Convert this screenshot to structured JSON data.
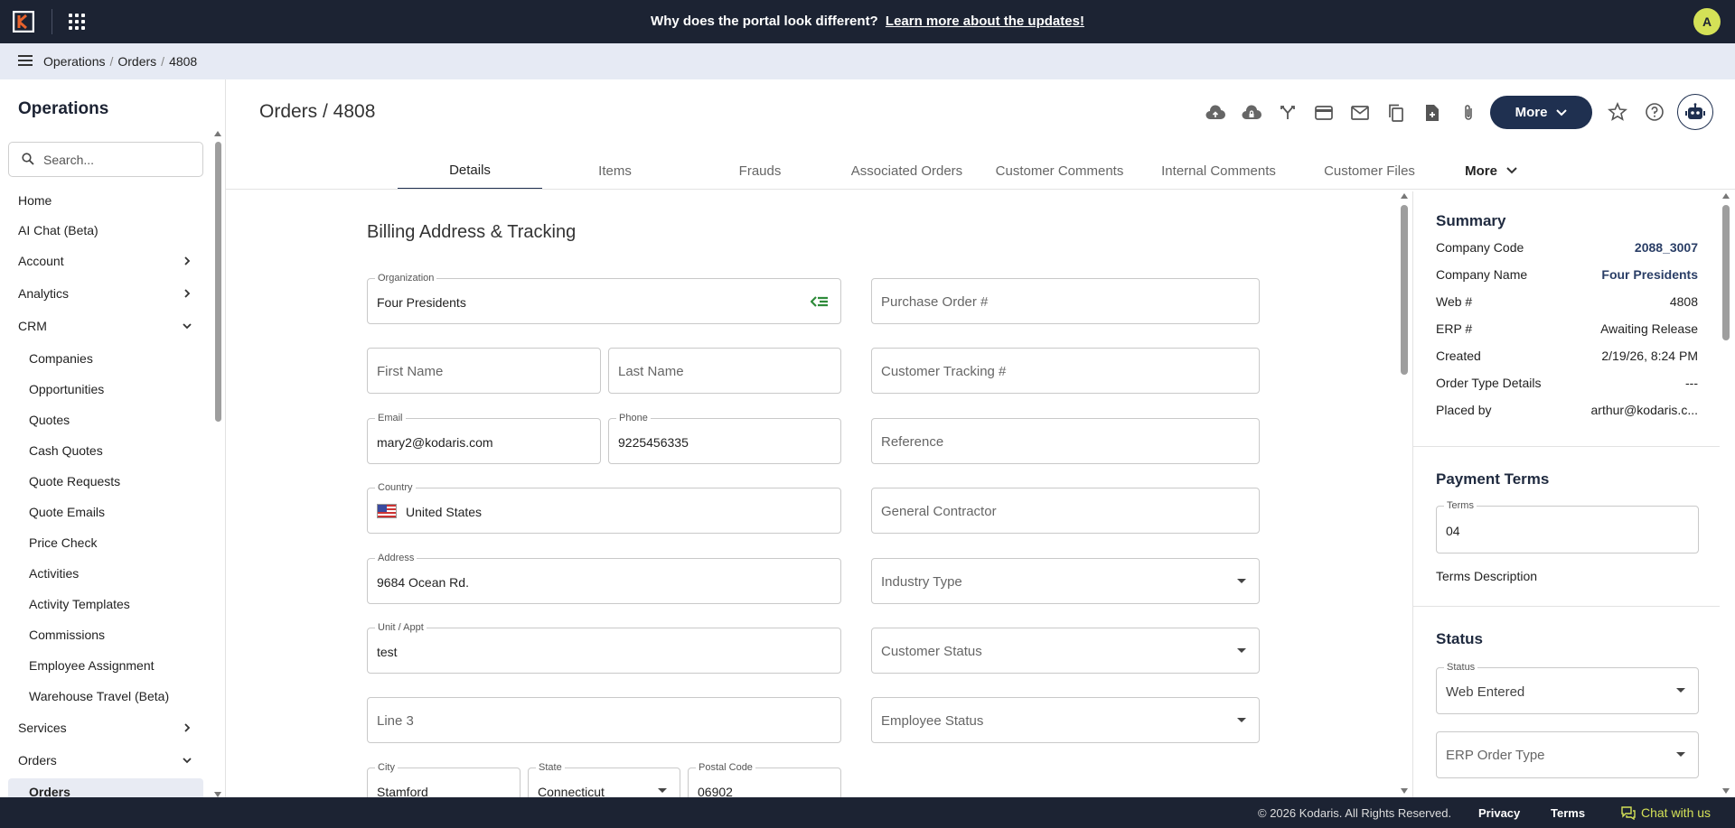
{
  "topbar": {
    "announcement": "Why does the portal look different?",
    "announcement_link": "Learn more about the updates!",
    "avatar_initial": "A"
  },
  "breadcrumb": [
    "Operations",
    "Orders",
    "4808"
  ],
  "sidebar": {
    "title": "Operations",
    "search_placeholder": "Search...",
    "items": [
      {
        "label": "Home",
        "level": "top"
      },
      {
        "label": "AI Chat (Beta)",
        "level": "top"
      },
      {
        "label": "Account",
        "level": "top",
        "chevron": "right"
      },
      {
        "label": "Analytics",
        "level": "top",
        "chevron": "right"
      },
      {
        "label": "CRM",
        "level": "top",
        "chevron": "down"
      },
      {
        "label": "Companies",
        "level": "sub"
      },
      {
        "label": "Opportunities",
        "level": "sub"
      },
      {
        "label": "Quotes",
        "level": "sub"
      },
      {
        "label": "Cash Quotes",
        "level": "sub"
      },
      {
        "label": "Quote Requests",
        "level": "sub"
      },
      {
        "label": "Quote Emails",
        "level": "sub"
      },
      {
        "label": "Price Check",
        "level": "sub"
      },
      {
        "label": "Activities",
        "level": "sub"
      },
      {
        "label": "Activity Templates",
        "level": "sub"
      },
      {
        "label": "Commissions",
        "level": "sub"
      },
      {
        "label": "Employee Assignment",
        "level": "sub"
      },
      {
        "label": "Warehouse Travel (Beta)",
        "level": "sub"
      },
      {
        "label": "Services",
        "level": "top",
        "chevron": "right"
      },
      {
        "label": "Orders",
        "level": "top",
        "chevron": "down"
      },
      {
        "label": "Orders",
        "level": "sub",
        "active": true
      }
    ]
  },
  "header": {
    "title": "Orders / 4808",
    "more_label": "More",
    "toolbar_icons": [
      "cloud-upload-icon",
      "cloud-lock-icon",
      "merge-icon",
      "credit-card-icon",
      "mail-icon",
      "copy-icon",
      "file-add-icon",
      "attachment-icon"
    ]
  },
  "tabs": [
    {
      "label": "Details",
      "active": true
    },
    {
      "label": "Items"
    },
    {
      "label": "Frauds"
    },
    {
      "label": "Associated Orders"
    },
    {
      "label": "Customer Comments"
    },
    {
      "label": "Internal Comments"
    },
    {
      "label": "Customer Files"
    },
    {
      "label": "More"
    }
  ],
  "form": {
    "section_title": "Billing Address & Tracking",
    "organization": {
      "label": "Organization",
      "value": "Four Presidents"
    },
    "purchase_order": {
      "placeholder": "Purchase Order #"
    },
    "first_name": {
      "placeholder": "First Name"
    },
    "last_name": {
      "placeholder": "Last Name"
    },
    "customer_tracking": {
      "placeholder": "Customer Tracking #"
    },
    "email": {
      "label": "Email",
      "value": "mary2@kodaris.com"
    },
    "phone": {
      "label": "Phone",
      "value": "9225456335"
    },
    "reference": {
      "placeholder": "Reference"
    },
    "country": {
      "label": "Country",
      "value": "United States"
    },
    "general_contractor": {
      "placeholder": "General Contractor"
    },
    "address": {
      "label": "Address",
      "value": "9684 Ocean Rd."
    },
    "industry_type": {
      "placeholder": "Industry Type"
    },
    "unit": {
      "label": "Unit / Appt",
      "value": "test"
    },
    "customer_status": {
      "placeholder": "Customer Status"
    },
    "line3": {
      "placeholder": "Line 3"
    },
    "employee_status": {
      "placeholder": "Employee Status"
    },
    "city": {
      "label": "City",
      "value": "Stamford"
    },
    "state": {
      "label": "State",
      "value": "Connecticut"
    },
    "postal_code": {
      "label": "Postal Code",
      "value": "06902"
    }
  },
  "summary": {
    "title": "Summary",
    "rows": [
      {
        "key": "Company Code",
        "value": "2088_3007",
        "link": true
      },
      {
        "key": "Company Name",
        "value": "Four Presidents",
        "link": true
      },
      {
        "key": "Web #",
        "value": "4808"
      },
      {
        "key": "ERP #",
        "value": "Awaiting Release"
      },
      {
        "key": "Created",
        "value": "2/19/26, 8:24 PM"
      },
      {
        "key": "Order Type Details",
        "value": "---"
      },
      {
        "key": "Placed by",
        "value": "arthur@kodaris.c..."
      }
    ]
  },
  "payment_terms": {
    "title": "Payment Terms",
    "terms_label": "Terms",
    "terms_value": "04",
    "description_label": "Terms Description"
  },
  "status": {
    "title": "Status",
    "status_label": "Status",
    "status_value": "Web Entered",
    "erp_order_type_placeholder": "ERP Order Type"
  },
  "footer": {
    "copyright": "© 2026 Kodaris. All Rights Reserved.",
    "privacy": "Privacy",
    "terms": "Terms",
    "chat": "Chat with us"
  },
  "colors": {
    "topbar": "#1c2333",
    "accent": "#1f3050",
    "avatar": "#d4e157",
    "chat": "#d4e157",
    "crumbbar": "#e6eaf4"
  }
}
